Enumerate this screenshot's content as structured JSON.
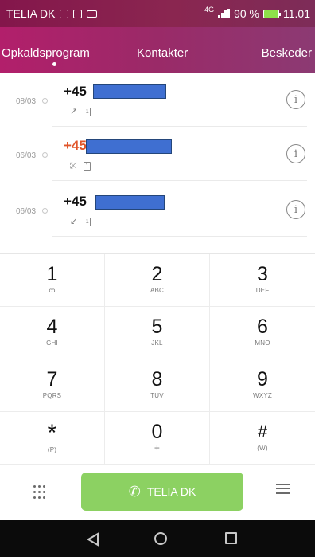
{
  "status_bar": {
    "carrier": "TELIA DK",
    "network": "4G",
    "battery": "90 %",
    "time": "11.01"
  },
  "tabs": [
    {
      "label": "Opkaldsprogram"
    },
    {
      "label": "Kontakter"
    },
    {
      "label": "Beskeder"
    }
  ],
  "call_log": [
    {
      "date": "08/03",
      "number_prefix": "+45",
      "missed": false
    },
    {
      "date": "06/03",
      "number_prefix": "+45",
      "missed": true
    },
    {
      "date": "06/03",
      "number_prefix": "+45",
      "missed": false
    }
  ],
  "keypad": {
    "keys": [
      {
        "digit": "1",
        "letters": "ꝏ"
      },
      {
        "digit": "2",
        "letters": "ABC"
      },
      {
        "digit": "3",
        "letters": "DEF"
      },
      {
        "digit": "4",
        "letters": "GHI"
      },
      {
        "digit": "5",
        "letters": "JKL"
      },
      {
        "digit": "6",
        "letters": "MNO"
      },
      {
        "digit": "7",
        "letters": "PQRS"
      },
      {
        "digit": "8",
        "letters": "TUV"
      },
      {
        "digit": "9",
        "letters": "WXYZ"
      },
      {
        "digit": "*",
        "letters": "(P)"
      },
      {
        "digit": "0",
        "letters": "+"
      },
      {
        "digit": "#",
        "letters": "(W)"
      }
    ]
  },
  "action_bar": {
    "call_label": "TELIA DK"
  },
  "colors": {
    "accent": "#b21f6b",
    "call_button": "#8cd162",
    "missed": "#e0552a"
  }
}
